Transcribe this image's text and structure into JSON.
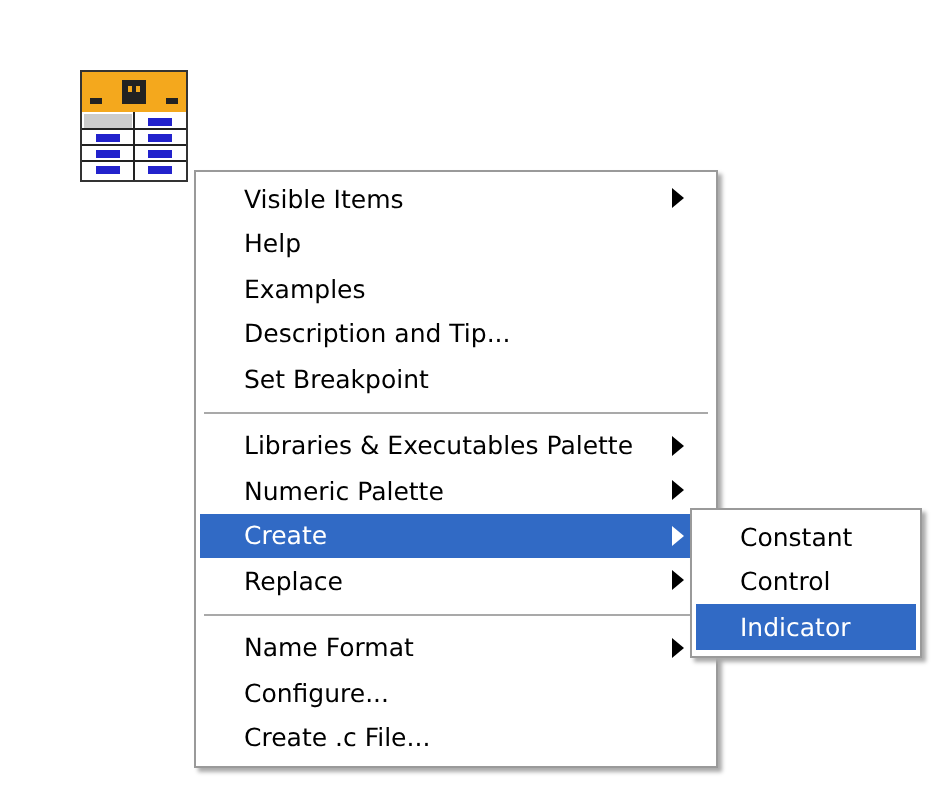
{
  "menu": {
    "groups": [
      {
        "items": [
          {
            "label": "Visible Items",
            "submenu": true,
            "selected": false
          },
          {
            "label": "Help",
            "submenu": false,
            "selected": false
          },
          {
            "label": "Examples",
            "submenu": false,
            "selected": false
          },
          {
            "label": "Description and Tip...",
            "submenu": false,
            "selected": false
          },
          {
            "label": "Set Breakpoint",
            "submenu": false,
            "selected": false
          }
        ]
      },
      {
        "items": [
          {
            "label": "Libraries & Executables Palette",
            "submenu": true,
            "selected": false
          },
          {
            "label": "Numeric Palette",
            "submenu": true,
            "selected": false
          },
          {
            "label": "Create",
            "submenu": true,
            "selected": true
          },
          {
            "label": "Replace",
            "submenu": true,
            "selected": false
          }
        ]
      },
      {
        "items": [
          {
            "label": "Name Format",
            "submenu": true,
            "selected": false
          },
          {
            "label": "Configure...",
            "submenu": false,
            "selected": false
          },
          {
            "label": "Create .c File...",
            "submenu": false,
            "selected": false
          }
        ]
      }
    ]
  },
  "submenu": {
    "items": [
      {
        "label": "Constant",
        "selected": false
      },
      {
        "label": "Control",
        "selected": false
      },
      {
        "label": "Indicator",
        "selected": true
      }
    ]
  }
}
